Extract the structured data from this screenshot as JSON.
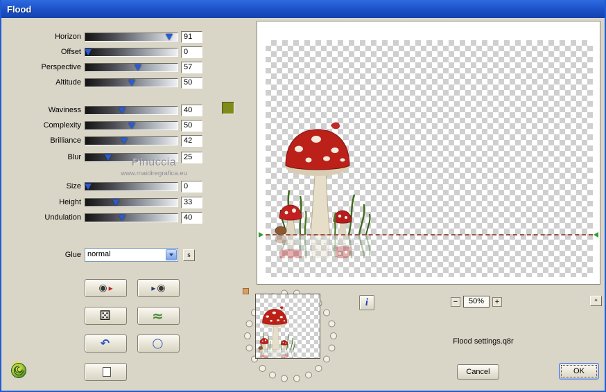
{
  "window": {
    "title": "Flood"
  },
  "colors": {
    "titlebar_blue": "#1f5bd5",
    "dialog_bg": "#d9d5c7",
    "water_swatch": "#7f8c1a",
    "slider_thumb": "#2a5ad4",
    "horizon_line": "#9a5248"
  },
  "sliders": [
    {
      "label": "Horizon",
      "value": 91
    },
    {
      "label": "Offset",
      "value": 0
    },
    {
      "label": "Perspective",
      "value": 57
    },
    {
      "label": "Altitude",
      "value": 50
    },
    {
      "label": "Waviness",
      "value": 40
    },
    {
      "label": "Complexity",
      "value": 50
    },
    {
      "label": "Brilliance",
      "value": 42
    },
    {
      "label": "Blur",
      "value": 25
    },
    {
      "label": "Size",
      "value": 0
    },
    {
      "label": "Height",
      "value": 33
    },
    {
      "label": "Undulation",
      "value": 40
    }
  ],
  "glue": {
    "label": "Glue",
    "value": "normal",
    "cycle_glyph": "s"
  },
  "watermark": {
    "line1": "Pinuccia",
    "line2": "www.maidiregrafica.eu"
  },
  "tool_buttons": [
    {
      "name": "load-preset-disc",
      "a": "◉",
      "b": "▸"
    },
    {
      "name": "save-preset-disc",
      "a": "▸",
      "b": "◉"
    },
    {
      "name": "random-dice",
      "a": "⚄",
      "b": ""
    },
    {
      "name": "waves",
      "a": "≈",
      "b": ""
    },
    {
      "name": "undo",
      "a": "↶",
      "b": ""
    },
    {
      "name": "circle",
      "a": "◯",
      "b": ""
    },
    {
      "name": "copy-pages",
      "a": "",
      "b": ""
    }
  ],
  "icons": {
    "combo_arrow": "chevron-down",
    "logo": "spiral-shell",
    "memory_ring": "dot-ring"
  },
  "preview": {
    "zoom": "50%",
    "zoom_out": "−",
    "zoom_in": "+",
    "info_glyph": "i",
    "caret_glyph": "^",
    "settings_text": "Flood settings.q8r"
  },
  "actions": {
    "cancel": "Cancel",
    "ok": "OK"
  }
}
